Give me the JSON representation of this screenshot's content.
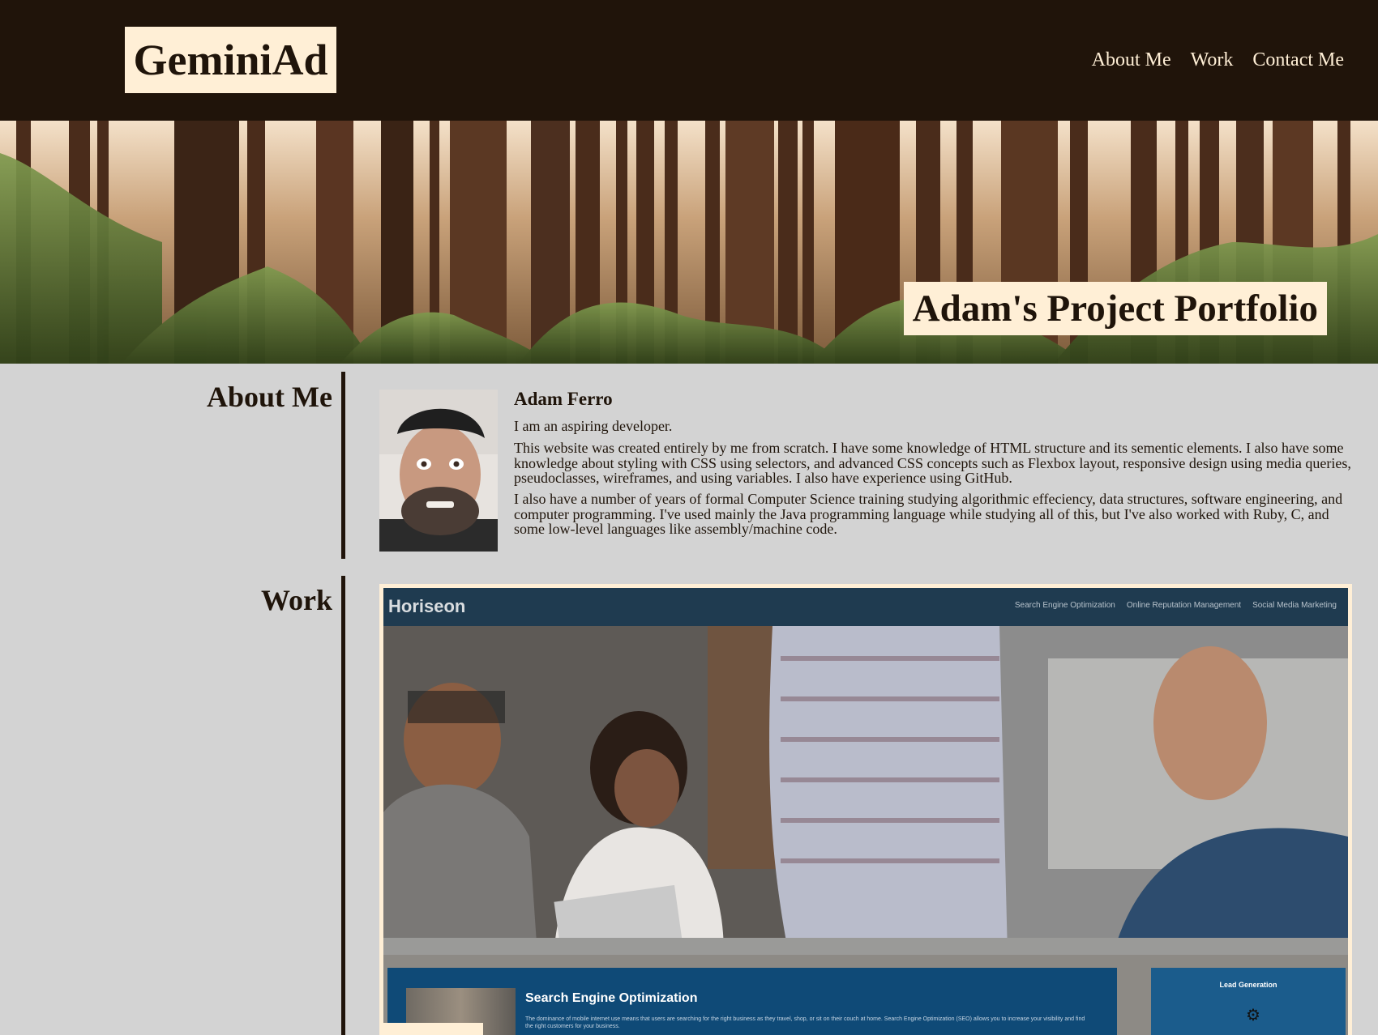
{
  "header": {
    "logo": "GeminiAd",
    "nav": [
      "About Me",
      "Work",
      "Contact Me"
    ]
  },
  "hero": {
    "title": "Adam's Project Portfolio"
  },
  "about": {
    "heading": "About Me",
    "name": "Adam Ferro",
    "paragraphs": [
      "I am an aspiring developer.",
      "This website was created entirely by me from scratch. I have some knowledge of HTML structure and its sementic elements. I also have some knowledge about styling with CSS using selectors, and advanced CSS concepts such as Flexbox layout, responsive design using media queries, pseudoclasses, wireframes, and using variables. I also have experience using GitHub.",
      "I also have a number of years of formal Computer Science training studying algorithmic effeciency, data structures, software engineering, and computer programming. I've used mainly the Java programming language while studying all of this, but I've also worked with Ruby, C, and some low-level languages like assembly/machine code."
    ]
  },
  "work": {
    "heading": "Work",
    "project": {
      "site_logo": "Horiseon",
      "site_nav": [
        "Search Engine Optimization",
        "Online Reputation Management",
        "Social Media Marketing"
      ],
      "card_title": "Search Engine Optimization",
      "card_text": "The dominance of mobile internet use means that users are searching for the right business as they travel, shop, or sit on their couch at home. Search Engine Optimization (SEO) allows you to increase your visibility and find the right customers for your business.",
      "side_title": "Lead Generation"
    }
  },
  "colors": {
    "header_bg": "#20140a",
    "accent_cream": "#ffefd6",
    "page_bg": "#d3d3d3",
    "horiseon_nav": "#1f3b50",
    "horiseon_card": "#0f4a77"
  }
}
